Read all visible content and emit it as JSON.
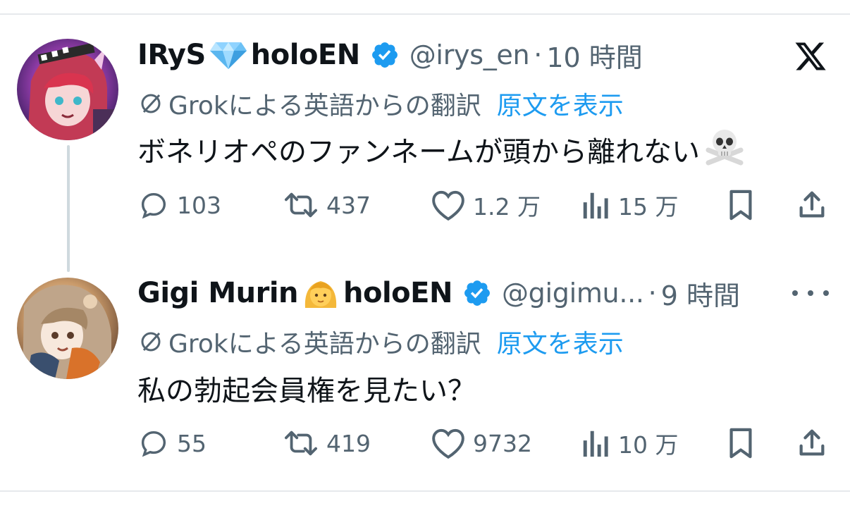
{
  "tweets": [
    {
      "display_name": "IRyS",
      "name_suffix": "holoEN",
      "handle": "@irys_en",
      "separator": "·",
      "time": "10 時間",
      "translation_label": "Grokによる英語からの翻訳",
      "show_original": "原文を表示",
      "text": "ボネリオペのファンネームが頭から離れない",
      "replies": "103",
      "reposts": "437",
      "likes": "1.2 万",
      "views": "15 万"
    },
    {
      "display_name": "Gigi Murin",
      "name_suffix": "holoEN",
      "handle": "@gigimu...",
      "separator": "·",
      "time": "9 時間",
      "translation_label": "Grokによる英語からの翻訳",
      "show_original": "原文を表示",
      "text": "私の勃起会員権を見たい？",
      "replies": "55",
      "reposts": "419",
      "likes": "9732",
      "views": "10 万"
    }
  ],
  "colors": {
    "text_primary": "#0f1419",
    "text_secondary": "#536471",
    "link_blue": "#1d9bf0",
    "verified_blue": "#1d9bf0",
    "divider": "#e6e9ec",
    "thread_line": "#cfd9de"
  },
  "icons": {
    "verified": "verified-badge-icon",
    "translate": "translate-icon",
    "reply": "reply-icon",
    "repost": "repost-icon",
    "like": "like-icon",
    "views": "views-icon",
    "bookmark": "bookmark-icon",
    "share": "share-icon",
    "x_logo": "x-logo-icon",
    "more": "more-icon"
  }
}
